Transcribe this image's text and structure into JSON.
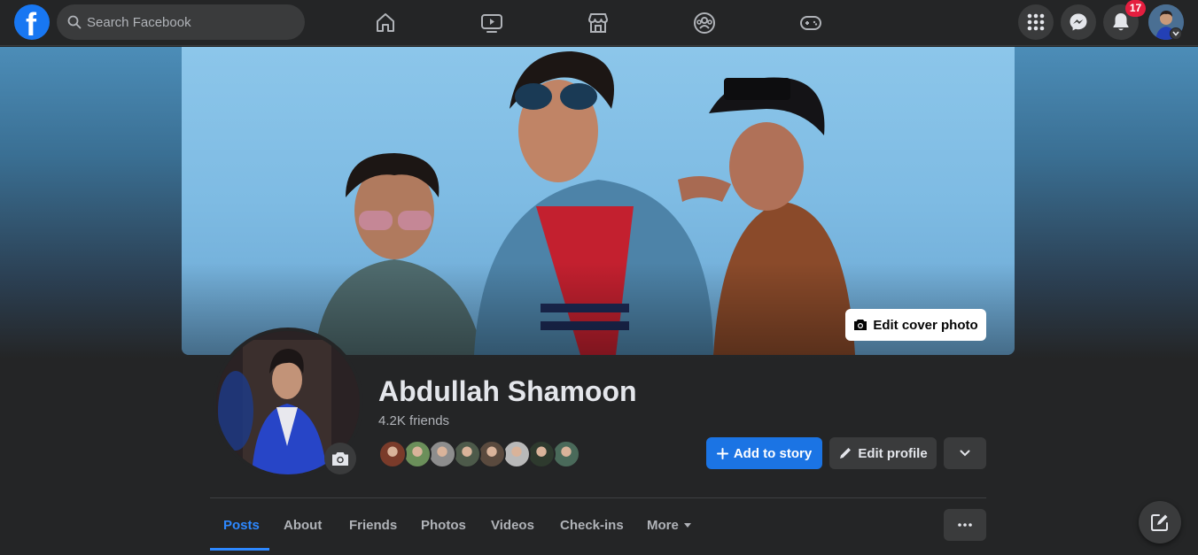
{
  "topbar": {
    "logo_letter": "f",
    "search_placeholder": "Search Facebook",
    "nav_icons": [
      "home-icon",
      "watch-icon",
      "marketplace-icon",
      "groups-icon",
      "gaming-icon"
    ],
    "notification_count": "17"
  },
  "cover": {
    "edit_cover_label": "Edit cover photo"
  },
  "profile": {
    "name": "Abdullah Shamoon",
    "friends_count": "4.2K friends",
    "friend_avatar_colors": [
      "#7a3b2a",
      "#6b8f5a",
      "#8d8d8d",
      "#4d5a4a",
      "#5a4a3e",
      "#b9b9b9",
      "#2e3a2e",
      "#4a6a5a"
    ]
  },
  "actions": {
    "add_story_label": "Add to story",
    "edit_profile_label": "Edit profile"
  },
  "tabs": {
    "posts": "Posts",
    "about": "About",
    "friends": "Friends",
    "photos": "Photos",
    "videos": "Videos",
    "checkins": "Check-ins",
    "more": "More"
  },
  "colors": {
    "accent": "#1b74e4",
    "active_tab": "#2d88ff",
    "background": "#242526",
    "badge": "#e41e3f"
  }
}
